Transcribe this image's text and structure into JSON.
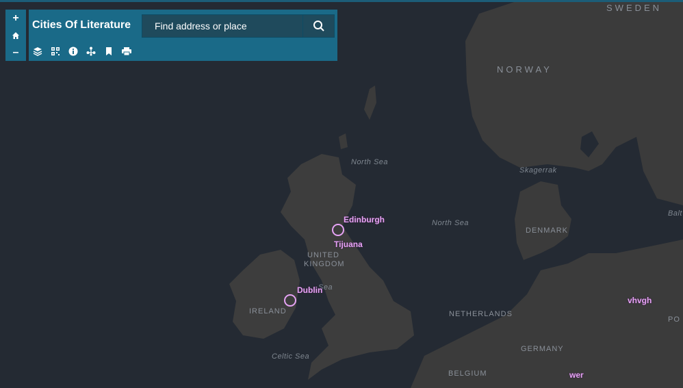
{
  "header": {
    "title": "Cities Of Literature"
  },
  "search": {
    "placeholder": "Find address or place"
  },
  "zoom": {
    "in": "+",
    "home": "⌂",
    "out": "–"
  },
  "toolbar": [
    {
      "icon": "layers-icon"
    },
    {
      "icon": "qr-legend-icon"
    },
    {
      "icon": "info-icon"
    },
    {
      "icon": "share-network-icon"
    },
    {
      "icon": "bookmark-icon"
    },
    {
      "icon": "print-icon"
    }
  ],
  "labels": {
    "sweden": "SWEDEN",
    "norway": "NORWAY",
    "north_sea_1": "North Sea",
    "north_sea_2": "North Sea",
    "skagerrak": "Skagerrak",
    "denmark": "DENMARK",
    "united": "UNITED",
    "kingdom": "KINGDOM",
    "irish_sea": "Sea",
    "ireland": "IRELAND",
    "netherlands": "NETHERLANDS",
    "germany": "GERMANY",
    "belgium": "BELGIUM",
    "celtic_sea": "Celtic Sea",
    "baltic": "Balt",
    "po": "PO"
  },
  "cities": {
    "edinburgh": "Edinburgh",
    "tijuana": "Tijuana",
    "dublin": "Dublin",
    "vhvgh": "vhvgh",
    "wer": "wer"
  },
  "colors": {
    "panel": "#1a6a88",
    "city": "#e6a3f5",
    "water": "#242a33",
    "land": "#3a3a3a"
  }
}
